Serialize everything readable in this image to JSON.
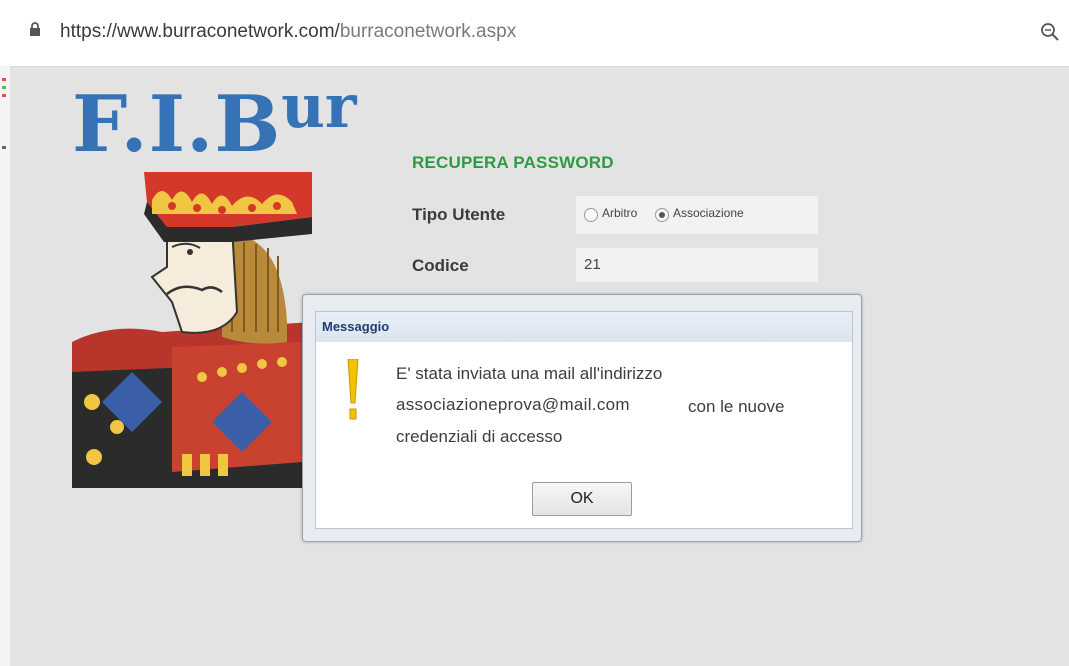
{
  "browser": {
    "url_domain": "https://www.burraconetwork.com/",
    "url_path": "burraconetwork.aspx"
  },
  "logo": {
    "main": "F.I.B",
    "sup": "ur"
  },
  "form": {
    "title": "RECUPERA PASSWORD",
    "tipo_label": "Tipo Utente",
    "options": [
      "Arbitro",
      "Associazione"
    ],
    "selected_option": "Associazione",
    "codice_label": "Codice",
    "codice_value": "21"
  },
  "dialog": {
    "title": "Messaggio",
    "line1": "E' stata inviata una mail all'indirizzo",
    "email": "associazioneprova@mail.com",
    "line2_suffix": "con le nuove",
    "line3": "credenziali di accesso",
    "ok_label": "OK"
  },
  "colors": {
    "logo_blue": "#3572b6",
    "title_green": "#2f9b40",
    "warning_yellow": "#f2c200",
    "dialog_title_text": "#1d3f6d"
  },
  "icons": {
    "lock": "lock-icon",
    "zoom": "zoom-icon",
    "warning": "warning-icon"
  }
}
